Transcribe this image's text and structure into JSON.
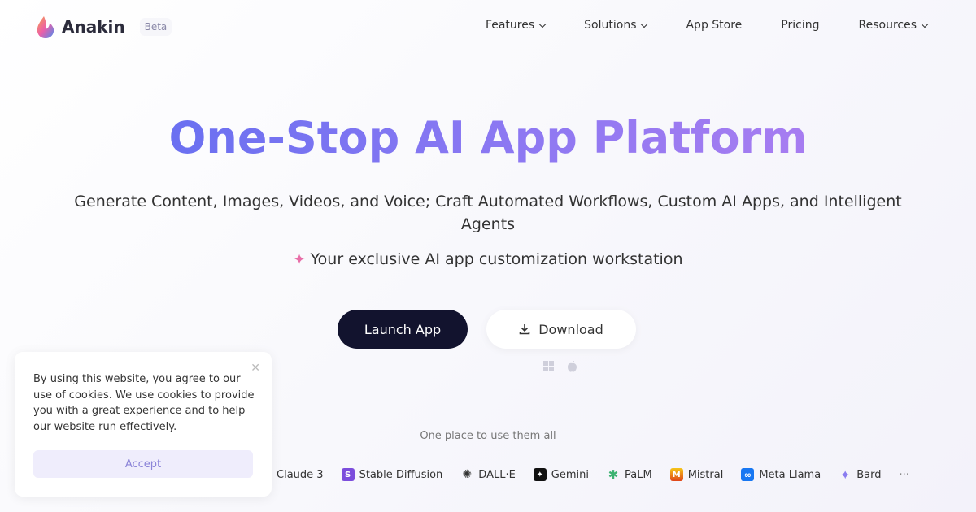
{
  "brand": {
    "name": "Anakin",
    "badge": "Beta"
  },
  "nav": [
    {
      "label": "Features",
      "dropdown": true
    },
    {
      "label": "Solutions",
      "dropdown": true
    },
    {
      "label": "App Store",
      "dropdown": false
    },
    {
      "label": "Pricing",
      "dropdown": false
    },
    {
      "label": "Resources",
      "dropdown": true
    }
  ],
  "hero": {
    "title": "One-Stop AI App Platform",
    "subtitle": "Generate Content, Images, Videos, and Voice; Craft Automated Workflows, Custom AI Apps, and Intelligent Agents",
    "tagline": "Your exclusive AI app customization workstation",
    "launch": "Launch App",
    "download": "Download"
  },
  "models_heading": "One place to use them all",
  "models": [
    {
      "label": "Claude 3",
      "icon": "claude-icon"
    },
    {
      "label": "Stable Diffusion",
      "icon": "stable-diffusion-icon",
      "color": "#7c4ddc"
    },
    {
      "label": "DALL·E",
      "icon": "openai-icon"
    },
    {
      "label": "Gemini",
      "icon": "gemini-icon",
      "color": "#111111"
    },
    {
      "label": "PaLM",
      "icon": "palm-icon"
    },
    {
      "label": "Mistral",
      "icon": "mistral-icon",
      "color": "#f07a1a"
    },
    {
      "label": "Meta Llama",
      "icon": "meta-icon",
      "color": "#1877f2"
    },
    {
      "label": "Bard",
      "icon": "bard-icon"
    }
  ],
  "more": "···",
  "cookie": {
    "text": "By using this website, you agree to our use of cookies. We use cookies to provide you with a great experience and to help our website run effectively.",
    "accept": "Accept"
  }
}
